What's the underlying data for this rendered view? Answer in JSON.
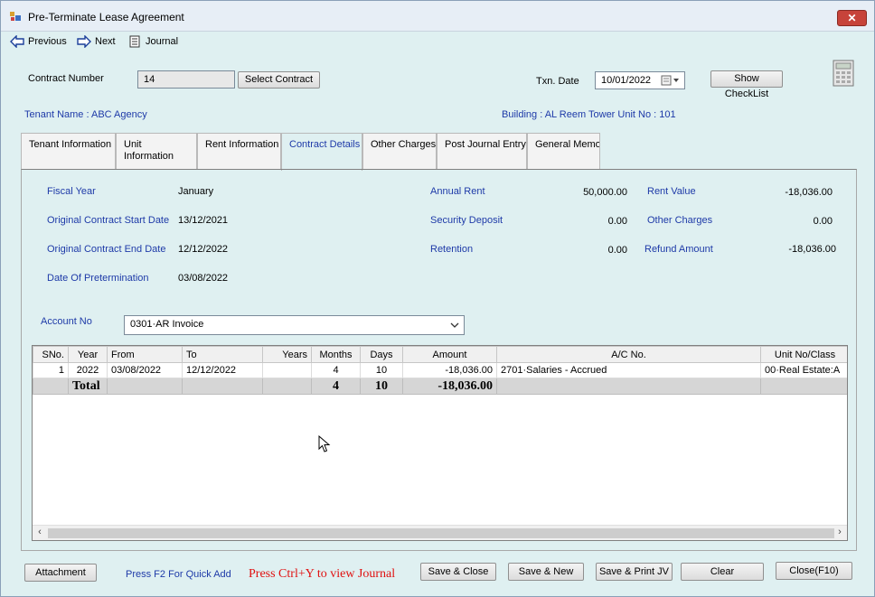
{
  "window": {
    "title": "Pre-Terminate Lease Agreement",
    "close_glyph": "✕"
  },
  "toolbar": {
    "previous": "Previous",
    "next": "Next",
    "journal": "Journal"
  },
  "header": {
    "contract_number_label": "Contract Number",
    "contract_number_value": "14",
    "select_contract": "Select Contract",
    "txn_date_label": "Txn. Date",
    "txn_date_value": "10/01/2022",
    "show_checklist": "Show CheckList"
  },
  "info": {
    "tenant": "Tenant Name : ABC Agency",
    "building": "Building : AL Reem Tower  Unit No : 101"
  },
  "tabs": [
    {
      "label": "Tenant Information"
    },
    {
      "label": "Unit\nInformation"
    },
    {
      "label": "Rent Information"
    },
    {
      "label": "Contract Details"
    },
    {
      "label": "Other Charges"
    },
    {
      "label": "Post Journal Entry"
    },
    {
      "label": "General Memo"
    }
  ],
  "details": {
    "fiscal_year_label": "Fiscal Year",
    "fiscal_year_value": "January",
    "start_label": "Original Contract Start Date",
    "start_value": "13/12/2021",
    "end_label": "Original Contract End Date",
    "end_value": "12/12/2022",
    "pret_label": "Date Of Pretermination",
    "pret_value": "03/08/2022",
    "annual_rent_label": "Annual Rent",
    "annual_rent_value": "50,000.00",
    "security_label": "Security Deposit",
    "security_value": "0.00",
    "retention_label": "Retention",
    "retention_value": "0.00",
    "rent_value_label": "Rent Value",
    "rent_value_value": "-18,036.00",
    "other_charges_label": "Other Charges",
    "other_charges_value": "0.00",
    "refund_label": "Refund Amount",
    "refund_value": "-18,036.00"
  },
  "account": {
    "label": "Account No",
    "value": "0301·AR Invoice"
  },
  "grid": {
    "columns": [
      "SNo.",
      "Year",
      "From",
      "To",
      "Years",
      "Months",
      "Days",
      "Amount",
      "A/C No.",
      "Unit No/Class"
    ],
    "rows": [
      {
        "sno": "1",
        "year": "2022",
        "from": "03/08/2022",
        "to": "12/12/2022",
        "years": "",
        "months": "4",
        "days": "10",
        "amount": "-18,036.00",
        "acno": "2701·Salaries - Accrued",
        "unit": "00·Real Estate:A"
      }
    ],
    "total": {
      "label": "Total",
      "months": "4",
      "days": "10",
      "amount": "-18,036.00"
    }
  },
  "footer": {
    "attachment": "Attachment",
    "quick_add": "Press F2 For Quick Add",
    "ctrl_y": "Press Ctrl+Y to view Journal",
    "save_close": "Save & Close",
    "save_new": "Save & New",
    "save_print": "Save & Print JV",
    "clear": "Clear",
    "close": "Close(F10)"
  }
}
